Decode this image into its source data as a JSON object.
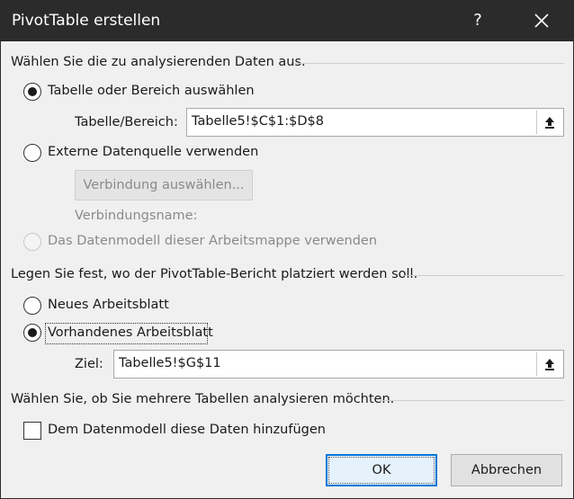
{
  "dialog": {
    "title": "PivotTable erstellen",
    "help_glyph": "?",
    "close_icon": "close-icon"
  },
  "source_section": {
    "heading": "Wählen Sie die zu analysierenden Daten aus.",
    "options": [
      {
        "label": "Tabelle oder Bereich auswählen",
        "selected": true,
        "enabled": true
      },
      {
        "label": "Externe Datenquelle verwenden",
        "selected": false,
        "enabled": true
      },
      {
        "label": "Das Datenmodell dieser Arbeitsmappe verwenden",
        "selected": false,
        "enabled": false
      }
    ],
    "range_label": "Tabelle/Bereich:",
    "range_value": "Tabelle5!$C$1:$D$8",
    "choose_connection_button": "Verbindung auswählen...",
    "connection_name_label": "Verbindungsname:"
  },
  "placement_section": {
    "heading": "Legen Sie fest, wo der PivotTable-Bericht platziert werden soll.",
    "options": [
      {
        "label": "Neues Arbeitsblatt",
        "selected": false
      },
      {
        "label": "Vorhandenes Arbeitsblatt",
        "selected": true
      }
    ],
    "target_label": "Ziel:",
    "target_value": "Tabelle5!$G$11"
  },
  "multi_table_section": {
    "heading": "Wählen Sie, ob Sie mehrere Tabellen analysieren möchten.",
    "data_model_checkbox_label": "Dem Datenmodell diese Daten hinzufügen",
    "data_model_checked": false
  },
  "buttons": {
    "ok": "OK",
    "cancel": "Abbrechen"
  },
  "colors": {
    "titlebar": "#2b2b2b",
    "dialog_bg": "#f0f0f0",
    "accent": "#0078d7"
  }
}
